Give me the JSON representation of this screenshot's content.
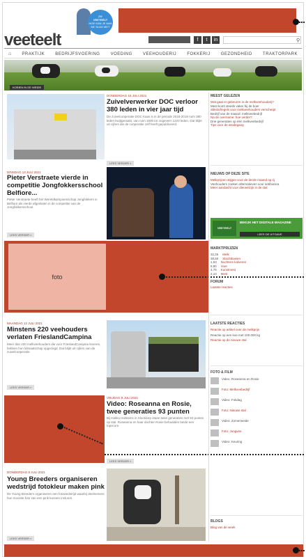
{
  "header": {
    "logo": "veeteelt",
    "promo_line1": "ZIE",
    "promo_line2": "VEETEELT",
    "promo_line3": "HOE KAN JE AAN",
    "promo_line4": "DE SLAG MET",
    "toolbar_labels": [
      "f",
      "t",
      "in"
    ]
  },
  "nav": {
    "home_icon": "home-icon",
    "items": [
      "PRAKTIJK",
      "BEDRIJFSVOERING",
      "VOEDING",
      "VEEHOUDERIJ",
      "FOKKERIJ",
      "GEZONDHEID",
      "TRAKTORPARK"
    ]
  },
  "hero": {
    "caption": "KOEIEN IN DE WEIDE"
  },
  "articles": [
    {
      "meta": "DONDERDAG 15 JULI 2021",
      "title": "Zuivelverwerker DOC verloor 380 leden in vier jaar tijd",
      "body": "De zuivelcoöperatie DOC Kaas is in de periode 2016-2019 ruim 380 leden kwijtgeraakt, van ruim 1600 tot ongeveer 1220 leden. Dat blijkt uit cijfers die de coöperatie zelf heeft gepubliceerd."
    },
    {
      "meta": "DINSDAG 13 JULI 2021",
      "title": "Pieter Verstraete vierde in competitie Jongfokkersschool Belfiore...",
      "body": "Pieter Verstraete heeft het Wereldkampioenschap Jongfokkers in Belfiore als vierde afgesloten in de competitie van de Jongfokkersschool."
    },
    {
      "meta": "MAANDAG 12 JULI 2021",
      "title": "Minstens 220 veehouders verlaten FrieslandCampina",
      "body": "Meer dan 220 melkveehouders die voor FrieslandCampina leveren, hebben hun lidmaatschap opgezegd. Dat blijkt uit cijfers van de zuivelcoöperatie."
    },
    {
      "meta": "VRIJDAG 9 JULI 2021",
      "title": "Video: Roseanna en Rosie, twee generaties 93 punten",
      "body": "Bij Hakko Holsteins in Slootdorp staan twee generaties met 93 punten op stal. Roseanna en haar dochter Rosie behaalden beide een topscore."
    },
    {
      "meta": "DONDERDAG 8 JULI 2021",
      "title": "Young Breeders organiseren wedstrijd fotokleur maken pink",
      "body": "De Young Breeders organiseren een fotowedstrijd waarbij deelnemers hun mooiste foto van een pink kunnen insturen."
    }
  ],
  "read_more": "LEES VERDER »",
  "ad_block": {
    "label": "foto"
  },
  "sidebar": {
    "popular_title": "MEEST GELEZEN",
    "popular_links": [
      "Wat gaat er gebeuren in de melkveehouderij?",
      "Mest komt steeds vaker bij de boer",
      "Stikstofregels voor melkveehouders verscherpt",
      "Bedrijf van de maand: melkveebedrijf",
      "Na de overname: hoe verder?",
      "Drie generaties op één melkveebedrijf",
      "Tips voor de weidegang"
    ],
    "news_title": "NIEUWS OP DEZE SITE",
    "news_links": [
      "Melkprijzen stijgen voor de derde maand op rij",
      "Veehouders zoeken alternatieven voor antibiotica",
      "Meer aandacht voor dierwelzijn in de stal"
    ],
    "green_ad_label1": "VEETEELT",
    "green_ad_label2": "BEKIJK HET DIGITALE MAGAZINE",
    "green_ad_cta": "LEES DE UITGAVE",
    "prices_title": "MARKTPRIJZEN",
    "prices": [
      {
        "value": "32,25",
        "label": "Melk"
      },
      {
        "value": "38,50",
        "label": "Slachtkoeien"
      },
      {
        "value": "1,53",
        "label": "Nuchtere kalveren"
      },
      {
        "value": "8,90",
        "label": "Voer"
      },
      {
        "value": "4,75",
        "label": "Kunstmest"
      },
      {
        "value": "2,10",
        "label": "Mest"
      }
    ],
    "forum_title": "FORUM",
    "forum_link": "Laatste reacties",
    "latest_title": "LAATSTE REACTIES",
    "latest_links": [
      "Reactie op artikel over de melkprijs",
      "Reactie op een koe met 100.000 kg",
      "Reactie op de nieuwe stal"
    ],
    "photo_title": "FOTO & FILM",
    "photo_items": [
      "Video: Roseanna en Rosie",
      "Foto: Melkveebedrijf",
      "Video: Fokdag",
      "Foto: Nieuwe stal",
      "Video: Zomerweide",
      "Foto: Jongvee",
      "Video: Keuring"
    ],
    "blogs_title": "BLOGS",
    "blogs_link": "Blog van de week"
  }
}
